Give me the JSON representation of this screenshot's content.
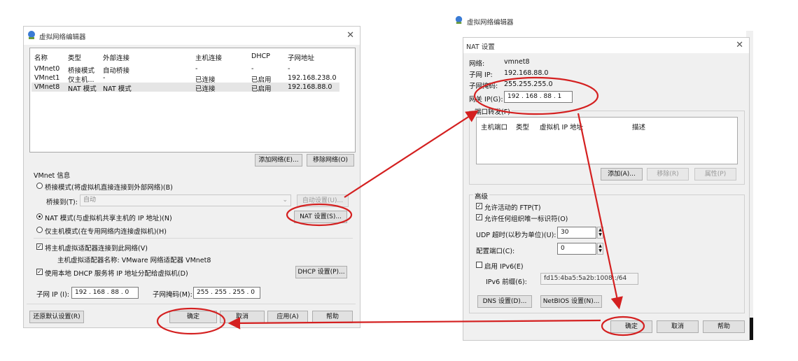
{
  "left_window": {
    "title": "虚拟网络编辑器",
    "columns": [
      "名称",
      "类型",
      "外部连接",
      "主机连接",
      "DHCP",
      "子网地址"
    ],
    "rows": [
      [
        "VMnet0",
        "桥接模式",
        "自动桥接",
        "-",
        "-",
        "-"
      ],
      [
        "VMnet1",
        "仅主机...",
        "-",
        "已连接",
        "已启用",
        "192.168.238.0"
      ],
      [
        "VMnet8",
        "NAT 模式",
        "NAT 模式",
        "已连接",
        "已启用",
        "192.168.88.0"
      ]
    ],
    "add_network": "添加网络(E)...",
    "remove_network": "移除网络(O)",
    "vmnet_info": "VMnet 信息",
    "bridge_mode": "桥接模式(将虚拟机直接连接到外部网络)(B)",
    "bridge_to_label": "桥接到(T):",
    "bridge_to_value": "自动",
    "auto_settings": "自动设置(U)...",
    "nat_mode": "NAT 模式(与虚拟机共享主机的 IP 地址)(N)",
    "nat_settings": "NAT 设置(S)...",
    "host_only": "仅主机模式(在专用网络内连接虚拟机)(H)",
    "connect_adapter": "将主机虚拟适配器连接到此网络(V)",
    "adapter_name": "主机虚拟适配器名称: VMware 网络适配器 VMnet8",
    "use_dhcp": "使用本地 DHCP 服务将 IP 地址分配给虚拟机(D)",
    "dhcp_settings": "DHCP 设置(P)...",
    "subnet_ip_label": "子网 IP (I):",
    "subnet_ip": "192 . 168 . 88 . 0",
    "subnet_mask_label": "子网掩码(M):",
    "subnet_mask": "255 . 255 . 255 . 0",
    "restore_defaults": "还原默认设置(R)",
    "ok": "确定",
    "cancel": "取消",
    "apply": "应用(A)",
    "help": "帮助"
  },
  "right_window": {
    "parent_title": "虚拟网络编辑器",
    "title": "NAT 设置",
    "network_label": "网络:",
    "network_value": "vmnet8",
    "subnet_ip_label": "子网 IP:",
    "subnet_ip_value": "192.168.88.0",
    "subnet_mask_label": "子网掩码:",
    "subnet_mask_value": "255.255.255.0",
    "gateway_label": "网关 IP(G):",
    "gateway_value": "192 . 168 . 88 . 1",
    "port_forward": "端口转发(F)",
    "pf_columns": [
      "主机端口",
      "类型",
      "虚拟机 IP 地址",
      "描述"
    ],
    "pf_add": "添加(A)...",
    "pf_remove": "移除(R)",
    "pf_props": "属性(P)",
    "advanced": "高级",
    "allow_ftp": "允许活动的 FTP(T)",
    "allow_uuid": "允许任何组织唯一标识符(O)",
    "udp_timeout_label": "UDP 超时(以秒为单位)(U):",
    "udp_timeout": "30",
    "config_port_label": "配置端口(C):",
    "config_port": "0",
    "enable_ipv6": "启用 IPv6(E)",
    "ipv6_prefix_label": "IPv6 前缀(6):",
    "ipv6_prefix": "fd15:4ba5:5a2b:1008::/64",
    "dns_settings": "DNS 设置(D)...",
    "netbios_settings": "NetBIOS 设置(N)...",
    "ok": "确定",
    "cancel": "取消",
    "help": "帮助"
  },
  "annotation_color": "#d42020"
}
